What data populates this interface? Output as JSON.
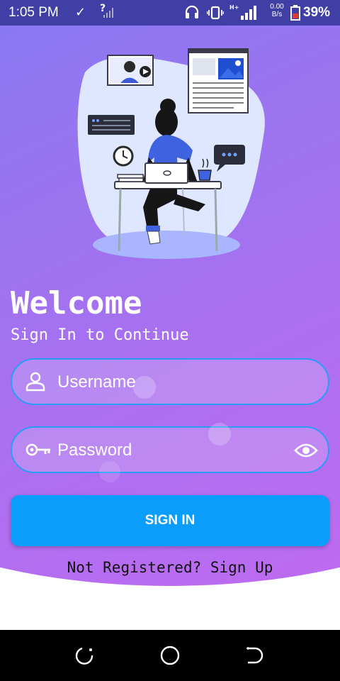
{
  "status_bar": {
    "time": "1:05 PM",
    "unknown_signal": "?",
    "network_type": "H+",
    "net_speed_value": "0.00",
    "net_speed_unit": "B/s",
    "battery_percent": "39%"
  },
  "login": {
    "welcome": "Welcome",
    "subtitle": "Sign In to Continue",
    "username_placeholder": "Username",
    "password_placeholder": "Password",
    "sign_in_label": "SIGN IN",
    "signup_text": "Not Registered? Sign Up"
  },
  "icons": {
    "username": "user-icon",
    "password": "key-icon",
    "visibility": "eye-icon",
    "nav_back": "back-icon",
    "nav_home": "home-icon",
    "nav_recent": "recent-apps-icon"
  },
  "colors": {
    "status_bar": "#3f3fa6",
    "gradient_start": "#6f7ff5",
    "gradient_end": "#c469f1",
    "field_border": "#2a9df4",
    "button": "#0a9dfb"
  }
}
